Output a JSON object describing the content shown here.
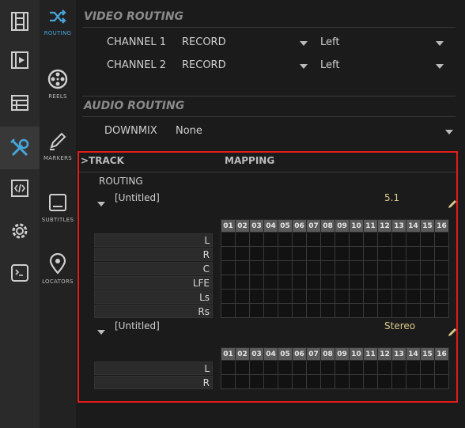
{
  "rail_primary": {
    "icons": [
      "film-strip-icon",
      "play-clip-icon",
      "list-panel-icon",
      "tools-icon",
      "code-icon",
      "gear-icon",
      "terminal-icon"
    ],
    "active": "tools-icon"
  },
  "rail_secondary": {
    "items": [
      {
        "label": "ROUTING",
        "icon": "shuffle-icon"
      },
      {
        "label": "REELS",
        "icon": "reel-icon"
      },
      {
        "label": "MARKERS",
        "icon": "marker-pen-icon"
      },
      {
        "label": "SUBTITLES",
        "icon": "subtitles-icon"
      },
      {
        "label": "LOCATORS",
        "icon": "map-pin-icon"
      }
    ],
    "active": "ROUTING"
  },
  "video_routing": {
    "title": "VIDEO ROUTING",
    "rows": [
      {
        "label": "CHANNEL 1",
        "source": "RECORD",
        "side": "Left"
      },
      {
        "label": "CHANNEL 2",
        "source": "RECORD",
        "side": "Left"
      }
    ]
  },
  "audio_routing": {
    "title": "AUDIO ROUTING",
    "downmix_label": "DOWNMIX",
    "downmix_value": "None"
  },
  "track_mapping": {
    "track_header": ">TRACK",
    "mapping_header": "MAPPING",
    "routing_label": "ROUTING",
    "columns": [
      "01",
      "02",
      "03",
      "04",
      "05",
      "06",
      "07",
      "08",
      "09",
      "10",
      "11",
      "12",
      "13",
      "14",
      "15",
      "16"
    ],
    "tracks": [
      {
        "name": "[Untitled]",
        "format": "5.1",
        "channels": [
          "L",
          "R",
          "C",
          "LFE",
          "Ls",
          "Rs"
        ]
      },
      {
        "name": "[Untitled]",
        "format": "Stereo",
        "channels": [
          "L",
          "R"
        ]
      }
    ]
  },
  "colors": {
    "accent": "#46a6dc",
    "highlight": "#e31b1b",
    "format_text": "#d8c88a"
  }
}
